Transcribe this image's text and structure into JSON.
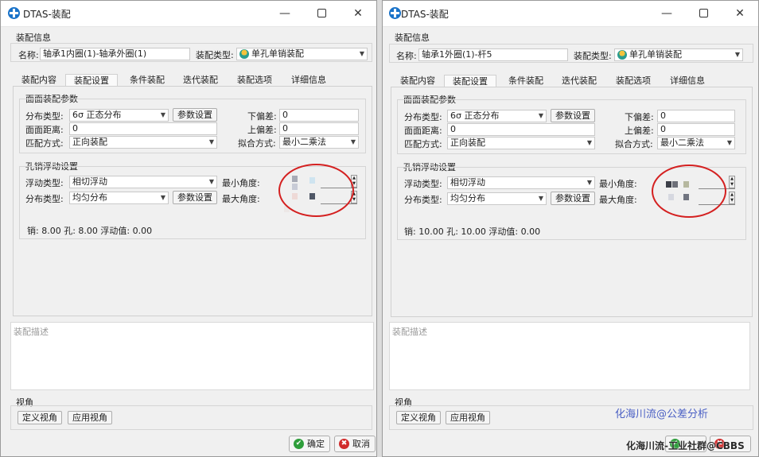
{
  "windows": [
    {
      "title": "DTAS-装配",
      "title_buttons": {
        "minimize": "—",
        "close": "✕"
      },
      "section_info": "装配信息",
      "name_label": "名称:",
      "name_value": "轴承1内圈(1)-轴承外圈(1)",
      "type_label": "装配类型:",
      "type_value": "单孔单销装配",
      "tabs": [
        "装配内容",
        "装配设置",
        "条件装配",
        "迭代装配",
        "装配选项",
        "详细信息"
      ],
      "active_tab": "装配设置",
      "face_group": {
        "title": "面面装配参数",
        "dist_type_label": "分布类型:",
        "dist_type_value": "6σ 正态分布",
        "param_btn": "参数设置",
        "lower_dev_label": "下偏差:",
        "lower_dev_value": "0",
        "face_dist_label": "面面距离:",
        "face_dist_value": "0",
        "upper_dev_label": "上偏差:",
        "upper_dev_value": "0",
        "match_label": "匹配方式:",
        "match_value": "正向装配",
        "fit_label": "拟合方式:",
        "fit_value": "最小二乘法"
      },
      "hole_group": {
        "title": "孔销浮动设置",
        "float_type_label": "浮动类型:",
        "float_type_value": "相切浮动",
        "min_angle_label": "最小角度:",
        "dist_type_label": "分布类型:",
        "dist_type_value": "均匀分布",
        "param_btn": "参数设置",
        "max_angle_label": "最大角度:",
        "summary": "销: 8.00  孔: 8.00  浮动值: 0.00"
      },
      "desc_placeholder": "装配描述",
      "view_section": "视角",
      "define_view_btn": "定义视角",
      "apply_view_btn": "应用视角",
      "ok_label": "确定",
      "cancel_label": "取消"
    },
    {
      "title": "DTAS-装配",
      "title_buttons": {
        "minimize": "—",
        "close": "✕"
      },
      "section_info": "装配信息",
      "name_label": "名称:",
      "name_value": "轴承1外圈(1)-杆5",
      "type_label": "装配类型:",
      "type_value": "单孔单销装配",
      "tabs": [
        "装配内容",
        "装配设置",
        "条件装配",
        "迭代装配",
        "装配选项",
        "详细信息"
      ],
      "active_tab": "装配设置",
      "face_group": {
        "title": "面面装配参数",
        "dist_type_label": "分布类型:",
        "dist_type_value": "6σ 正态分布",
        "param_btn": "参数设置",
        "lower_dev_label": "下偏差:",
        "lower_dev_value": "0",
        "face_dist_label": "面面距离:",
        "face_dist_value": "0",
        "upper_dev_label": "上偏差:",
        "upper_dev_value": "0",
        "match_label": "匹配方式:",
        "match_value": "正向装配",
        "fit_label": "拟合方式:",
        "fit_value": "最小二乘法"
      },
      "hole_group": {
        "title": "孔销浮动设置",
        "float_type_label": "浮动类型:",
        "float_type_value": "相切浮动",
        "min_angle_label": "最小角度:",
        "dist_type_label": "分布类型:",
        "dist_type_value": "均匀分布",
        "param_btn": "参数设置",
        "max_angle_label": "最大角度:",
        "summary": "销: 10.00  孔: 10.00  浮动值: 0.00"
      },
      "desc_placeholder": "装配描述",
      "view_section": "视角",
      "define_view_btn": "定义视角",
      "apply_view_btn": "应用视角"
    }
  ],
  "watermark_top": "化海川流@公差分析",
  "watermark_bottom": "化海川流-工业社群@CBBS",
  "colors": {
    "ellipse": "#d42020",
    "watermark": "#4a5fc4",
    "ok": "#2e9e3b",
    "cancel": "#d12b2b"
  }
}
